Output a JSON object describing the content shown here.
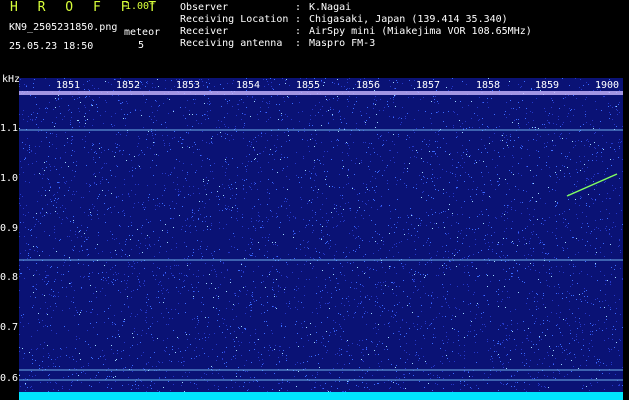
{
  "header": {
    "app_title": "H R O F F T",
    "version": "1.00f",
    "filename": "KN9_2505231850.png",
    "datetime": "25.05.23 18:50",
    "mode_label": "meteor",
    "mode_value": "5"
  },
  "info": [
    {
      "key": "Observer",
      "sep": ":",
      "value": "K.Nagai"
    },
    {
      "key": "Receiving Location",
      "sep": ":",
      "value": "Chigasaki, Japan (139.414 35.340)"
    },
    {
      "key": "Receiver",
      "sep": ":",
      "value": "AirSpy mini (Miakejima VOR 108.65MHz)"
    },
    {
      "key": "Receiving antenna",
      "sep": ":",
      "value": "Maspro FM-3"
    }
  ],
  "plot": {
    "unit": "kHz",
    "y_ticks": [
      "1.1",
      "1.0",
      "0.9",
      "0.8",
      "0.7",
      "0.6"
    ],
    "x_ticks": [
      "1851",
      "1852",
      "1853",
      "1854",
      "1855",
      "1856",
      "1857",
      "1858",
      "1859",
      "1900"
    ],
    "background_color": "#0a1275",
    "noise_color": "#3a6bff",
    "line_color": "#7fd0ff",
    "meteor_color": "#80ff60",
    "baseline_color": "#00e5ff"
  }
}
